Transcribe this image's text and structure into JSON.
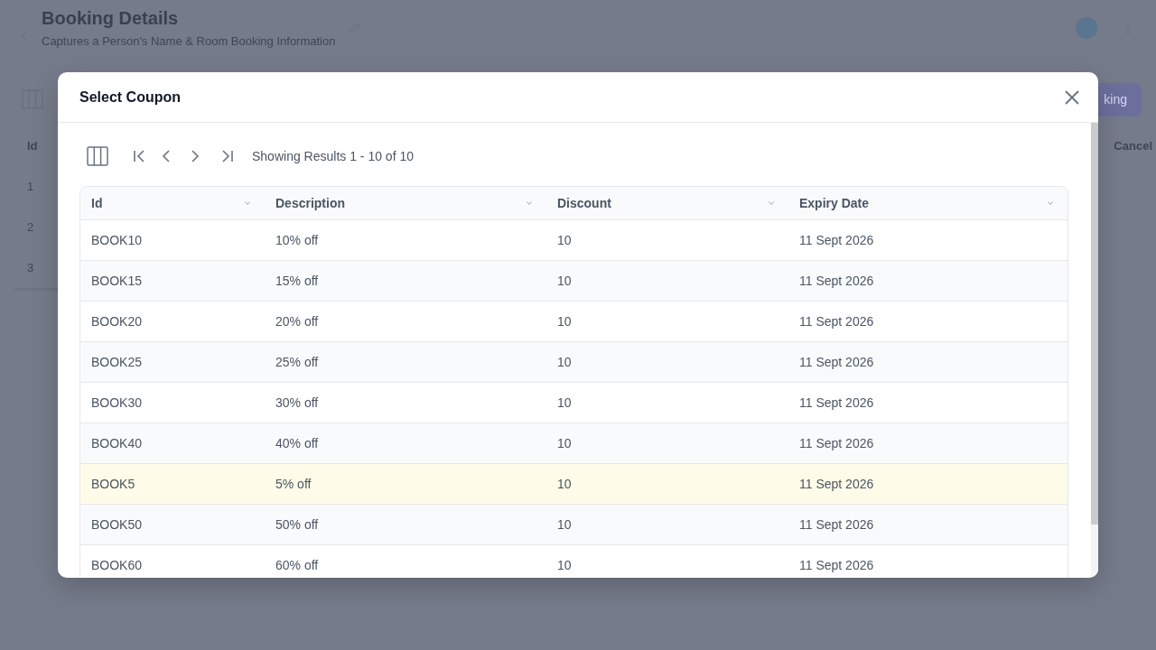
{
  "page": {
    "title": "Booking Details",
    "subtitle": "Captures a Person's Name & Room Booking Information",
    "action_button": "king",
    "cancel_link": "Cancel",
    "table": {
      "columns": [
        "Id"
      ],
      "rows": [
        "1",
        "2",
        "3"
      ]
    }
  },
  "modal": {
    "title": "Select Coupon",
    "pager_text": "Showing Results 1 - 10 of 10",
    "table": {
      "columns": [
        "Id",
        "Description",
        "Discount",
        "Expiry Date"
      ],
      "rows": [
        {
          "cells": [
            "BOOK10",
            "10% off",
            "10",
            "11 Sept 2026"
          ],
          "selected": false
        },
        {
          "cells": [
            "BOOK15",
            "15% off",
            "10",
            "11 Sept 2026"
          ],
          "selected": false
        },
        {
          "cells": [
            "BOOK20",
            "20% off",
            "10",
            "11 Sept 2026"
          ],
          "selected": false
        },
        {
          "cells": [
            "BOOK25",
            "25% off",
            "10",
            "11 Sept 2026"
          ],
          "selected": false
        },
        {
          "cells": [
            "BOOK30",
            "30% off",
            "10",
            "11 Sept 2026"
          ],
          "selected": false
        },
        {
          "cells": [
            "BOOK40",
            "40% off",
            "10",
            "11 Sept 2026"
          ],
          "selected": false
        },
        {
          "cells": [
            "BOOK5",
            "5% off",
            "10",
            "11 Sept 2026"
          ],
          "selected": true
        },
        {
          "cells": [
            "BOOK50",
            "50% off",
            "10",
            "11 Sept 2026"
          ],
          "selected": false
        },
        {
          "cells": [
            "BOOK60",
            "60% off",
            "10",
            "11 Sept 2026"
          ],
          "selected": false
        }
      ]
    }
  }
}
